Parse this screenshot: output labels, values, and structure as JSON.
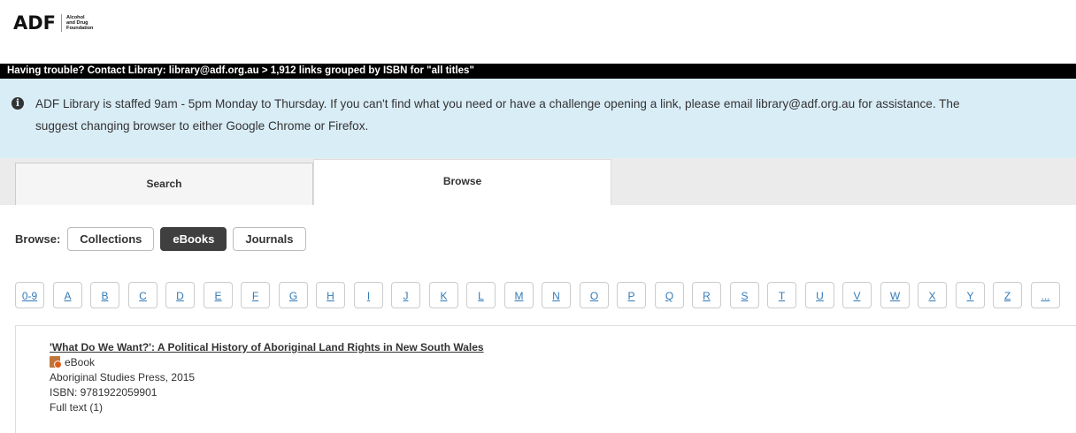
{
  "logo": {
    "mark": "ADF",
    "text_lines": [
      "Alcohol",
      "and Drug",
      "Foundation"
    ]
  },
  "banner": {
    "text": "Having trouble? Contact Library: library@adf.org.au >  1,912 links grouped by ISBN for \"all titles\""
  },
  "alert": {
    "icon": "info-icon",
    "line1": "ADF Library is staffed 9am - 5pm Monday to Thursday. If you can't find what you need or have a challenge opening a link, please email library@adf.org.au for assistance. The",
    "line2": "suggest changing browser to either Google Chrome or Firefox."
  },
  "tabs": [
    {
      "label": "Search",
      "active": false
    },
    {
      "label": "Browse",
      "active": true
    }
  ],
  "browse": {
    "label": "Browse:",
    "buttons": [
      {
        "label": "Collections",
        "active": false
      },
      {
        "label": "eBooks",
        "active": true
      },
      {
        "label": "Journals",
        "active": false
      }
    ]
  },
  "letters": [
    "0-9",
    "A",
    "B",
    "C",
    "D",
    "E",
    "F",
    "G",
    "H",
    "I",
    "J",
    "K",
    "L",
    "M",
    "N",
    "O",
    "P",
    "Q",
    "R",
    "S",
    "T",
    "U",
    "V",
    "W",
    "X",
    "Y",
    "Z",
    "..."
  ],
  "result": {
    "title": "'What Do We Want?': A Political History of Aboriginal Land Rights in New South Wales",
    "type": "eBook",
    "type_icon": "ebook-icon",
    "publisher": "Aboriginal Studies Press, 2015",
    "isbn": "ISBN: 9781922059901",
    "fulltext": "Full text (1)"
  },
  "colors": {
    "link": "#337ab7",
    "alert_bg": "#d9edf7",
    "banner_bg": "#000000",
    "active_button": "#3f3f3f"
  }
}
